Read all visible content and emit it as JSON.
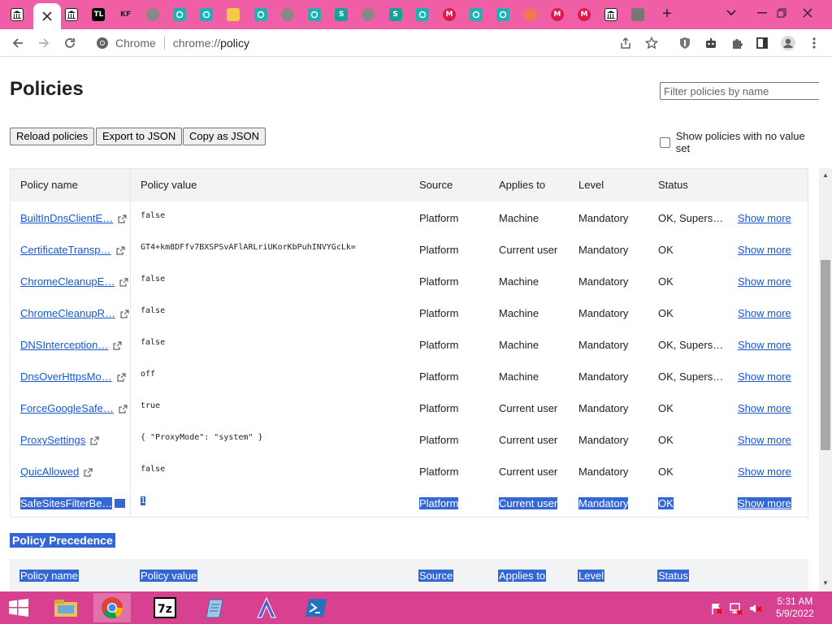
{
  "browser": {
    "tabs": [
      {
        "icon": "bank-favicon"
      },
      {
        "icon": "close-icon",
        "active": true
      },
      {
        "icon": "bank-favicon"
      },
      {
        "icon": "tl-favicon",
        "text": "TL"
      },
      {
        "icon": "kf-favicon",
        "text": "KF"
      },
      {
        "icon": "globe-favicon"
      },
      {
        "icon": "teal-gear-favicon"
      },
      {
        "icon": "teal-gear-favicon"
      },
      {
        "icon": "yellow-folder-favicon"
      },
      {
        "icon": "teal-gear-favicon"
      },
      {
        "icon": "globe-favicon"
      },
      {
        "icon": "teal-gear-favicon"
      },
      {
        "icon": "s-favicon",
        "text": "S"
      },
      {
        "icon": "globe-favicon"
      },
      {
        "icon": "s-favicon",
        "text": "S"
      },
      {
        "icon": "teal-gear-favicon"
      },
      {
        "icon": "m-favicon",
        "text": "M"
      },
      {
        "icon": "teal-gear-favicon"
      },
      {
        "icon": "teal-gear-favicon"
      },
      {
        "icon": "orange-favicon"
      },
      {
        "icon": "m-favicon",
        "text": "M"
      },
      {
        "icon": "m-favicon",
        "text": "M"
      },
      {
        "icon": "bank-favicon"
      },
      {
        "icon": "puzzle-favicon"
      }
    ],
    "new_tab_label": "+",
    "omnibox": {
      "site": "Chrome",
      "url_scheme": "chrome://",
      "url_path": "policy"
    }
  },
  "page": {
    "title": "Policies",
    "filter_placeholder": "Filter policies by name",
    "buttons": {
      "reload": "Reload policies",
      "export": "Export to JSON",
      "copy": "Copy as JSON"
    },
    "no_value_label": "Show policies with no value set",
    "columns": [
      "Policy name",
      "Policy value",
      "Source",
      "Applies to",
      "Level",
      "Status"
    ],
    "rows": [
      {
        "name": "BuiltInDnsClientE…",
        "value": "false",
        "source": "Platform",
        "applies": "Machine",
        "level": "Mandatory",
        "status": "OK, Supers…",
        "more": "Show more"
      },
      {
        "name": "CertificateTransp…",
        "value": "GT4+km8DFfv7BXSPSvAFlARLriUKorKbPuhINVYGcLk=",
        "source": "Platform",
        "applies": "Current user",
        "level": "Mandatory",
        "status": "OK",
        "more": "Show more"
      },
      {
        "name": "ChromeCleanupE…",
        "value": "false",
        "source": "Platform",
        "applies": "Machine",
        "level": "Mandatory",
        "status": "OK",
        "more": "Show more"
      },
      {
        "name": "ChromeCleanupR…",
        "value": "false",
        "source": "Platform",
        "applies": "Machine",
        "level": "Mandatory",
        "status": "OK",
        "more": "Show more"
      },
      {
        "name": "DNSInterception…",
        "value": "false",
        "source": "Platform",
        "applies": "Machine",
        "level": "Mandatory",
        "status": "OK, Supers…",
        "more": "Show more"
      },
      {
        "name": "DnsOverHttpsMo…",
        "value": "off",
        "source": "Platform",
        "applies": "Machine",
        "level": "Mandatory",
        "status": "OK, Supers…",
        "more": "Show more"
      },
      {
        "name": "ForceGoogleSafe…",
        "value": "true",
        "source": "Platform",
        "applies": "Current user",
        "level": "Mandatory",
        "status": "OK",
        "more": "Show more"
      },
      {
        "name": "ProxySettings",
        "value": "{ \"ProxyMode\": \"system\" }",
        "source": "Platform",
        "applies": "Current user",
        "level": "Mandatory",
        "status": "OK",
        "more": "Show more"
      },
      {
        "name": "QuicAllowed",
        "value": "false",
        "source": "Platform",
        "applies": "Current user",
        "level": "Mandatory",
        "status": "OK",
        "more": "Show more"
      },
      {
        "name": "SafeSitesFilterBe…",
        "value": "1",
        "source": "Platform",
        "applies": "Current user",
        "level": "Mandatory",
        "status": "OK",
        "more": "Show more",
        "selected": true
      }
    ],
    "precedence_heading": "Policy Precedence"
  },
  "taskbar": {
    "apps": [
      "start-icon",
      "file-explorer-icon",
      "chrome-icon",
      "7zip-icon",
      "notepad-icon",
      "app-a-icon",
      "powershell-icon"
    ],
    "time": "5:31 AM",
    "date": "5/9/2022"
  },
  "colors": {
    "tabstrip": "#f05fa6",
    "taskbar": "#d8418f",
    "selection": "#3367d6",
    "link": "#1558d6"
  }
}
